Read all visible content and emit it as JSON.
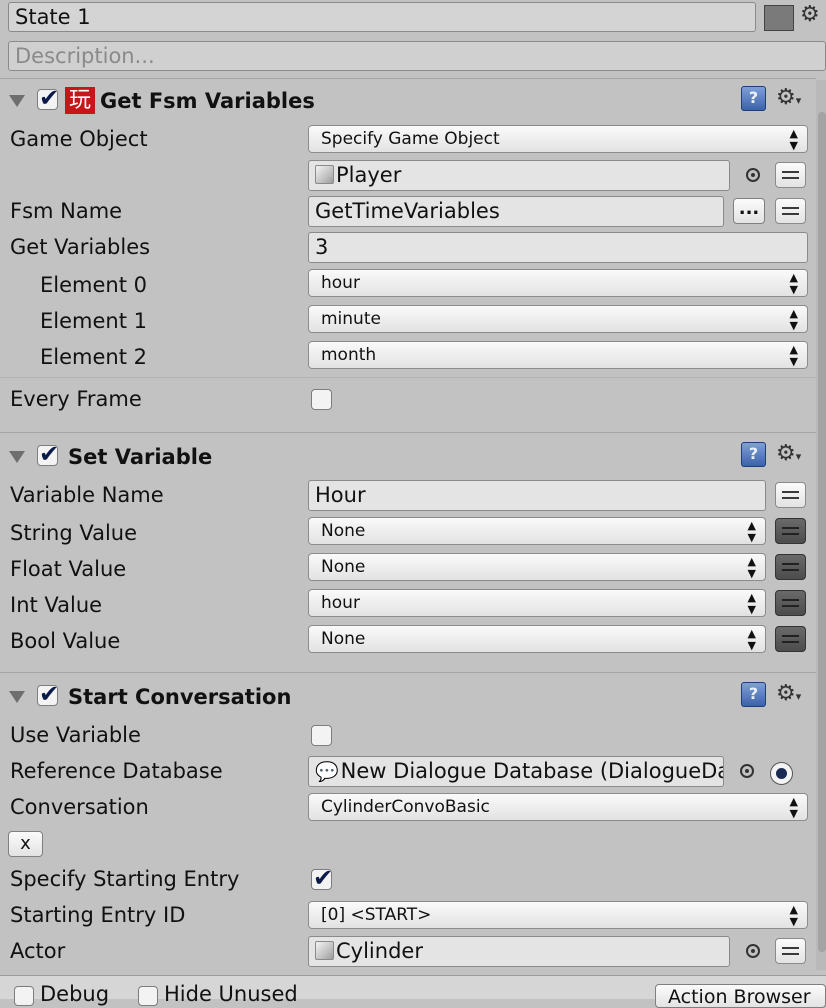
{
  "state": {
    "name": "State 1",
    "description_placeholder": "Description...",
    "color": "#7a7a7a"
  },
  "actions": [
    {
      "title": "Get Fsm Variables",
      "icon": "玩",
      "enabled": true,
      "rows": {
        "game_object_label": "Game Object",
        "game_object_value": "Specify Game Object",
        "player_value": "Player",
        "fsm_name_label": "Fsm Name",
        "fsm_name_value": "GetTimeVariables",
        "browse_label": "...",
        "get_variables_label": "Get Variables",
        "get_variables_count": "3",
        "elements": [
          {
            "label": "Element 0",
            "value": "hour"
          },
          {
            "label": "Element 1",
            "value": "minute"
          },
          {
            "label": "Element 2",
            "value": "month"
          }
        ],
        "every_frame_label": "Every Frame",
        "every_frame_checked": false
      }
    },
    {
      "title": "Set Variable",
      "enabled": true,
      "rows": {
        "variable_name_label": "Variable Name",
        "variable_name_value": "Hour",
        "string_value_label": "String Value",
        "string_value": "None",
        "float_value_label": "Float Value",
        "float_value": "None",
        "int_value_label": "Int Value",
        "int_value": "hour",
        "bool_value_label": "Bool Value",
        "bool_value": "None"
      }
    },
    {
      "title": "Start Conversation",
      "enabled": true,
      "rows": {
        "use_variable_label": "Use Variable",
        "use_variable_checked": false,
        "reference_database_label": "Reference Database",
        "reference_database_value": "New Dialogue Database (DialogueDa",
        "conversation_label": "Conversation",
        "conversation_value": "CylinderConvoBasic",
        "clear_button": "x",
        "specify_starting_entry_label": "Specify Starting Entry",
        "specify_starting_entry_checked": true,
        "starting_entry_id_label": "Starting Entry ID",
        "starting_entry_id_value": "[0] <START>",
        "actor_label": "Actor",
        "actor_value": "Cylinder"
      }
    }
  ],
  "bottom": {
    "debug_label": "Debug",
    "hide_unused_label": "Hide Unused",
    "action_browser_label": "Action Browser"
  }
}
